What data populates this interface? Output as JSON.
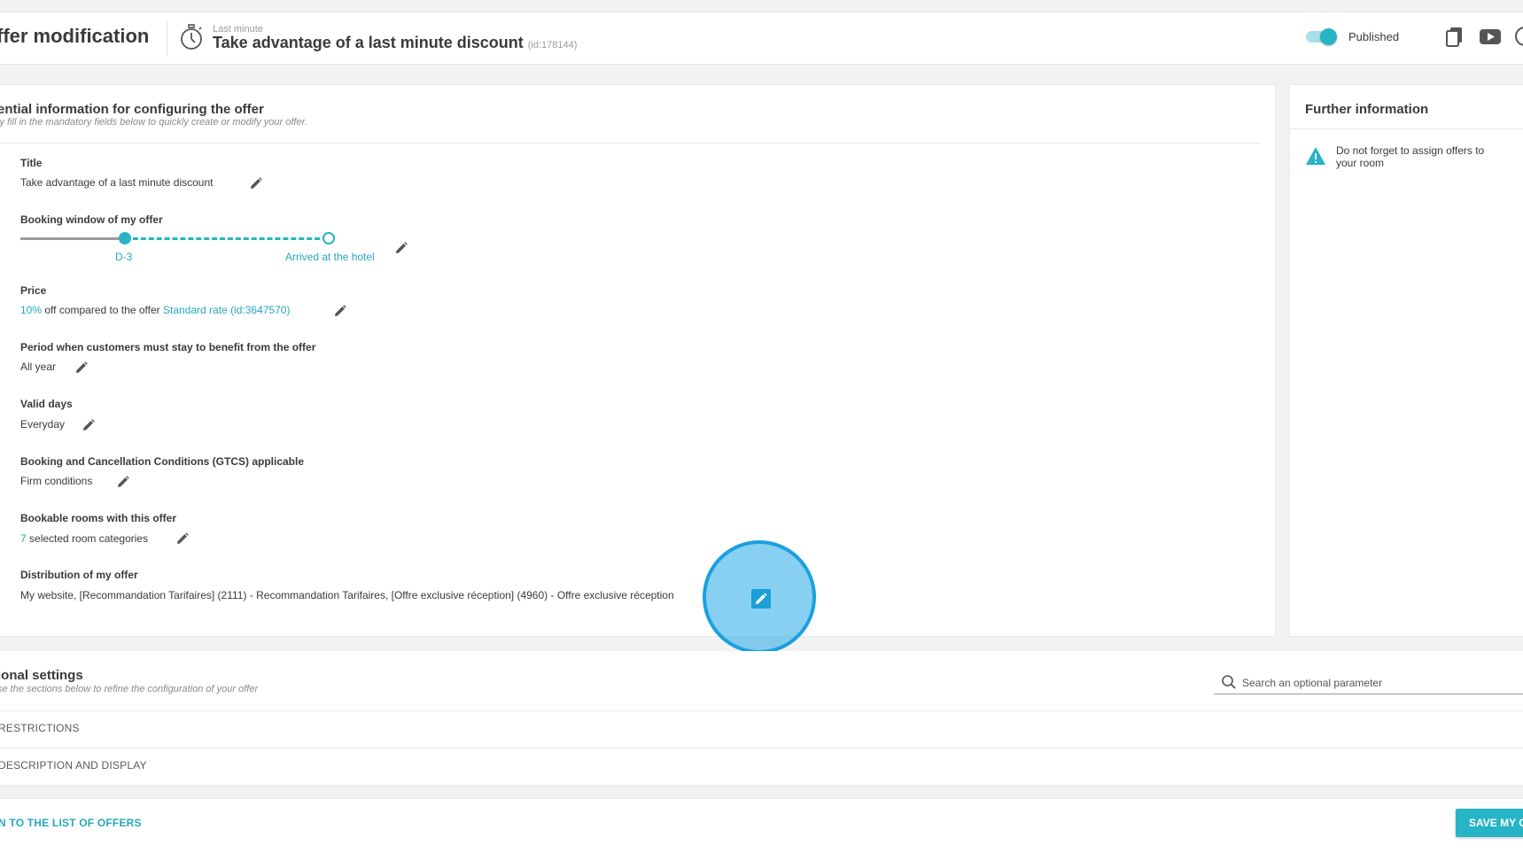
{
  "header": {
    "page_title": "ffer modification",
    "offer_kicker": "Last minute",
    "offer_title": "Take advantage of a last minute discount",
    "offer_id": "(id:178144)",
    "status_label": "Published",
    "status_on": true
  },
  "essential": {
    "title": "ential information for configuring the offer",
    "subtitle": "ly fill in the mandatory fields below to quickly create or modify your offer.",
    "fields": {
      "title": {
        "label": "Title",
        "value": "Take advantage of a last minute discount"
      },
      "booking_window": {
        "label": "Booking window of my offer",
        "start_label": "D-3",
        "end_label": "Arrived at the hotel"
      },
      "price": {
        "label": "Price",
        "percent": "10%",
        "middle": " off compared to the offer ",
        "rate_link": "Standard rate (id:3647570)"
      },
      "period": {
        "label": "Period when customers must stay to benefit from the offer",
        "value": "All year"
      },
      "valid_days": {
        "label": "Valid days",
        "value": "Everyday"
      },
      "gtcs": {
        "label": "Booking and Cancellation Conditions (GTCS) applicable",
        "value": "Firm conditions"
      },
      "rooms": {
        "label": "Bookable rooms with this offer",
        "count": "7",
        "suffix": " selected room categories"
      },
      "distribution": {
        "label": "Distribution of my offer",
        "value": "My website, [Recommandation Tarifaires] (2111) - Recommandation Tarifaires, [Offre exclusive réception] (4960) - Offre exclusive réception"
      }
    }
  },
  "further_info": {
    "title": "Further information",
    "warning_text": "Do not forget to assign offers to your room"
  },
  "optional": {
    "title": "ional settings",
    "subtitle": "se the sections below to refine the configuration of your offer",
    "search_placeholder": "Search an optional parameter",
    "sections": [
      "RESTRICTIONS",
      "DESCRIPTION AND DISPLAY"
    ]
  },
  "footer": {
    "return_label": "N TO THE LIST OF OFFERS",
    "save_label": "SAVE MY OFFER"
  },
  "colors": {
    "accent": "#26b4c6",
    "link": "#26a7bb",
    "click_highlight": "#1aa0e0"
  }
}
